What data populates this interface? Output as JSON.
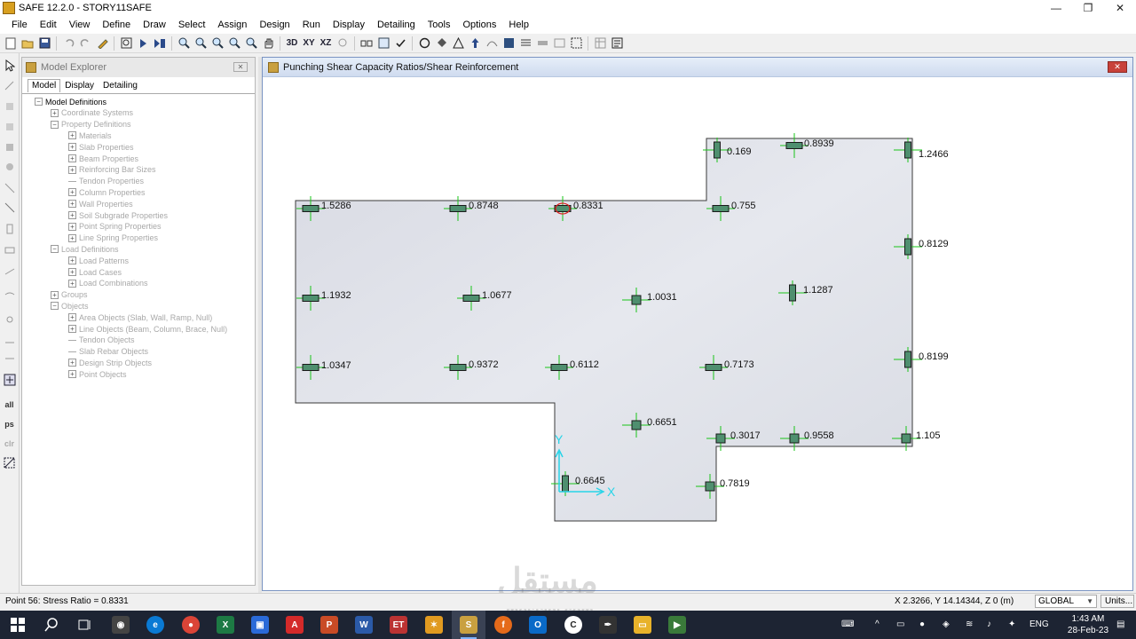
{
  "window": {
    "title": "SAFE 12.2.0 - STORY11SAFE",
    "controls": [
      "—",
      "❐",
      "✕"
    ]
  },
  "menu": [
    "File",
    "Edit",
    "View",
    "Define",
    "Draw",
    "Select",
    "Assign",
    "Design",
    "Run",
    "Display",
    "Detailing",
    "Tools",
    "Options",
    "Help"
  ],
  "toolbar": {
    "buttons": [
      "new-icon",
      "open-icon",
      "save-icon",
      "undo-icon",
      "redo-icon",
      "pencil-icon",
      "zoom-window-icon",
      "run-icon",
      "run-all-icon",
      "zoom-in-icon",
      "zoom-out-icon",
      "zoom-fit-icon",
      "zoom-prev-icon",
      "zoom-next-icon",
      "pan-icon",
      "3d-view",
      "xy-view",
      "xz-view",
      "rotate-icon",
      "object-shrink-icon",
      "set-display-icon",
      "check-icon",
      "circle-icon",
      "fill-icon",
      "triangle-icon",
      "arrow-up-icon",
      "curve-icon",
      "options-icon",
      "strip-icon",
      "slab-icon",
      "beam-icon",
      "grid-icon",
      "table-icon",
      "report-icon"
    ],
    "text_3d": "3D",
    "text_xy": "XY",
    "text_xz": "XZ"
  },
  "left_tools": {
    "all": "all",
    "ps": "ps",
    "clr": "clr"
  },
  "explorer": {
    "title": "Model Explorer",
    "close": "✕",
    "tabs": [
      "Model",
      "Display",
      "Detailing"
    ],
    "tree": [
      {
        "label": "Model Definitions",
        "level": 0,
        "expander": "−",
        "enabled": true
      },
      {
        "label": "Coordinate Systems",
        "level": 1,
        "expander": "+",
        "enabled": false
      },
      {
        "label": "Property Definitions",
        "level": 1,
        "expander": "−",
        "enabled": false
      },
      {
        "label": "Materials",
        "level": 2,
        "expander": "+",
        "enabled": false
      },
      {
        "label": "Slab Properties",
        "level": 2,
        "expander": "+",
        "enabled": false
      },
      {
        "label": "Beam Properties",
        "level": 2,
        "expander": "+",
        "enabled": false
      },
      {
        "label": "Reinforcing Bar Sizes",
        "level": 2,
        "expander": "+",
        "enabled": false
      },
      {
        "label": "Tendon Properties",
        "level": 2,
        "expander": "",
        "enabled": false
      },
      {
        "label": "Column Properties",
        "level": 2,
        "expander": "+",
        "enabled": false
      },
      {
        "label": "Wall Properties",
        "level": 2,
        "expander": "+",
        "enabled": false
      },
      {
        "label": "Soil Subgrade Properties",
        "level": 2,
        "expander": "+",
        "enabled": false
      },
      {
        "label": "Point Spring Properties",
        "level": 2,
        "expander": "+",
        "enabled": false
      },
      {
        "label": "Line Spring Properties",
        "level": 2,
        "expander": "+",
        "enabled": false
      },
      {
        "label": "Load Definitions",
        "level": 1,
        "expander": "−",
        "enabled": false
      },
      {
        "label": "Load Patterns",
        "level": 2,
        "expander": "+",
        "enabled": false
      },
      {
        "label": "Load Cases",
        "level": 2,
        "expander": "+",
        "enabled": false
      },
      {
        "label": "Load Combinations",
        "level": 2,
        "expander": "+",
        "enabled": false
      },
      {
        "label": "Groups",
        "level": 1,
        "expander": "+",
        "enabled": false
      },
      {
        "label": "Objects",
        "level": 1,
        "expander": "−",
        "enabled": false
      },
      {
        "label": "Area Objects (Slab, Wall, Ramp, Null)",
        "level": 2,
        "expander": "+",
        "enabled": false
      },
      {
        "label": "Line Objects (Beam, Column, Brace, Null)",
        "level": 2,
        "expander": "+",
        "enabled": false
      },
      {
        "label": "Tendon Objects",
        "level": 2,
        "expander": "",
        "enabled": false
      },
      {
        "label": "Slab Rebar Objects",
        "level": 2,
        "expander": "",
        "enabled": false
      },
      {
        "label": "Design Strip Objects",
        "level": 2,
        "expander": "+",
        "enabled": false
      },
      {
        "label": "Point Objects",
        "level": 2,
        "expander": "+",
        "enabled": false
      }
    ]
  },
  "document": {
    "title": "Punching Shear Capacity Ratios/Shear Reinforcement",
    "close": "✕",
    "axis_labels": {
      "x": "X",
      "y": "Y"
    },
    "columns": [
      {
        "ratio": "0.169",
        "orient": "v",
        "selected": false
      },
      {
        "ratio": "0.8939",
        "orient": "h",
        "selected": false
      },
      {
        "ratio": "1.2466",
        "orient": "v",
        "selected": false
      },
      {
        "ratio": "1.5286",
        "orient": "h",
        "selected": false
      },
      {
        "ratio": "0.8748",
        "orient": "h",
        "selected": false
      },
      {
        "ratio": "0.8331",
        "orient": "h",
        "selected": true
      },
      {
        "ratio": "0.755",
        "orient": "h",
        "selected": false
      },
      {
        "ratio": "0.8129",
        "orient": "v",
        "selected": false
      },
      {
        "ratio": "1.1932",
        "orient": "h",
        "selected": false
      },
      {
        "ratio": "1.0677",
        "orient": "h",
        "selected": false
      },
      {
        "ratio": "1.0031",
        "orient": "s",
        "selected": false
      },
      {
        "ratio": "1.1287",
        "orient": "v",
        "selected": false
      },
      {
        "ratio": "1.0347",
        "orient": "h",
        "selected": false
      },
      {
        "ratio": "0.9372",
        "orient": "h",
        "selected": false
      },
      {
        "ratio": "0.6112",
        "orient": "h",
        "selected": false
      },
      {
        "ratio": "0.7173",
        "orient": "h",
        "selected": false
      },
      {
        "ratio": "0.8199",
        "orient": "v",
        "selected": false
      },
      {
        "ratio": "0.6651",
        "orient": "s",
        "selected": false
      },
      {
        "ratio": "0.3017",
        "orient": "s",
        "selected": false
      },
      {
        "ratio": "0.9558",
        "orient": "s",
        "selected": false
      },
      {
        "ratio": "1.105",
        "orient": "s",
        "selected": false
      },
      {
        "ratio": "0.6645",
        "orient": "v",
        "selected": false
      },
      {
        "ratio": "0.7819",
        "orient": "s",
        "selected": false
      }
    ]
  },
  "status": {
    "selection": "Point 56:  Stress Ratio = 0.8331",
    "coords": "X 2.3266, Y 14.14344, Z 0  (m)",
    "coord_system": "GLOBAL",
    "units_button": "Units..."
  },
  "taskbar": {
    "apps": [
      "start-icon",
      "search-icon",
      "task-view-icon",
      "camera-icon",
      "edge-icon",
      "chrome-icon",
      "excel-icon",
      "store-icon",
      "acrobat-icon",
      "powerpoint-icon",
      "word-icon",
      "etabs-icon",
      "sketch-icon",
      "safe-icon",
      "firefox-icon",
      "outlook-icon",
      "clipchamp-icon",
      "inkscape-icon",
      "explorer-icon",
      "camtasia-icon"
    ],
    "language": "ENG",
    "time": "1:43 AM",
    "date": "28-Feb-23"
  },
  "colors": {
    "slab_fill": "#dcdee6",
    "column_fill": "#4f8f6f",
    "column_cross": "#19c419",
    "axis": "#27d4e8",
    "doc_header": "#cfdbef",
    "taskbar": "#1d2433"
  }
}
